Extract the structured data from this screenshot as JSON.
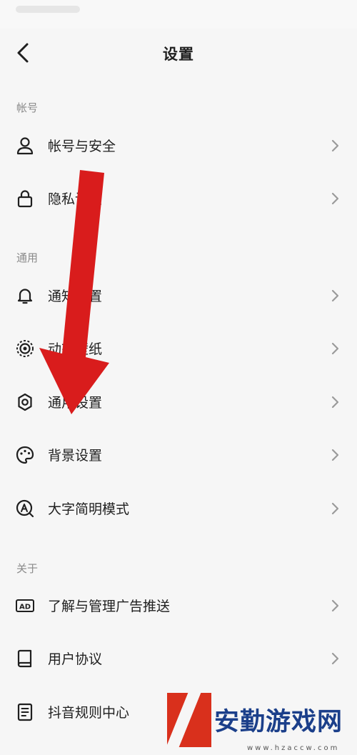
{
  "header": {
    "title": "设置"
  },
  "sections": [
    {
      "label": "帐号"
    },
    {
      "label": "通用"
    },
    {
      "label": "关于"
    }
  ],
  "rows": [
    {
      "label": "帐号与安全",
      "icon": "user-icon"
    },
    {
      "label": "隐私设置",
      "icon": "lock-icon"
    },
    {
      "label": "通知设置",
      "icon": "bell-icon"
    },
    {
      "label": "动态壁纸",
      "icon": "live-wallpaper-icon"
    },
    {
      "label": "通用设置",
      "icon": "gear-icon"
    },
    {
      "label": "背景设置",
      "icon": "palette-icon"
    },
    {
      "label": "大字简明模式",
      "icon": "large-text-icon"
    },
    {
      "label": "了解与管理广告推送",
      "icon": "ad-icon"
    },
    {
      "label": "用户协议",
      "icon": "book-icon"
    },
    {
      "label": "抖音规则中心",
      "icon": "document-icon"
    }
  ],
  "annotation": {
    "icon": "red-arrow-icon",
    "color": "#d91c1c"
  },
  "watermark": {
    "text": "安勤游戏网",
    "url": "www.hzaccw.com"
  }
}
